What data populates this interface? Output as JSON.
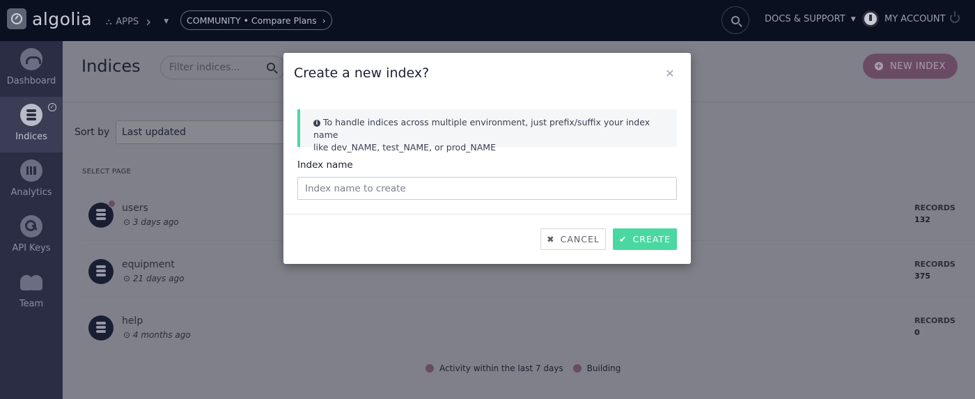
{
  "topbar": {
    "logo_text": "algolia",
    "apps_label": "APPS",
    "plan_label": "COMMUNITY • Compare Plans",
    "docs_label": "DOCS & SUPPORT",
    "account_label": "MY ACCOUNT"
  },
  "sidebar": {
    "items": [
      {
        "label": "Dashboard",
        "icon": "gauge-icon"
      },
      {
        "label": "Indices",
        "icon": "database-icon",
        "active": true
      },
      {
        "label": "Analytics",
        "icon": "bar-chart-icon"
      },
      {
        "label": "API Keys",
        "icon": "key-icon"
      },
      {
        "label": "Team",
        "icon": "team-icon"
      }
    ]
  },
  "main": {
    "title": "Indices",
    "filter_placeholder": "Filter indices...",
    "new_index_label": "NEW INDEX",
    "sort_label": "Sort by",
    "sort_value": "Last updated",
    "select_page_label": "SELECT PAGE",
    "records_label": "RECORDS",
    "indices": [
      {
        "name": "users",
        "time": "3 days ago",
        "records": "132",
        "activity": true
      },
      {
        "name": "equipment",
        "time": "21 days ago",
        "records": "375",
        "activity": false
      },
      {
        "name": "help",
        "time": "4 months ago",
        "records": "0",
        "activity": false
      }
    ],
    "legend": {
      "activity": "Activity within the last 7 days",
      "building": "Building"
    }
  },
  "modal": {
    "title": "Create a new index?",
    "info_line1": "To handle indices across multiple environment, just prefix/suffix your index name",
    "info_line2": "like dev_NAME, test_NAME, or prod_NAME",
    "field_label": "Index name",
    "field_placeholder": "Index name to create",
    "field_value": "",
    "cancel_label": "CANCEL",
    "create_label": "CREATE"
  },
  "colors": {
    "topbar_bg": "#0b1021",
    "sidebar_bg": "#2a2d44",
    "accent_green": "#4ad8a1",
    "new_index_bg": "#6a4b64"
  }
}
